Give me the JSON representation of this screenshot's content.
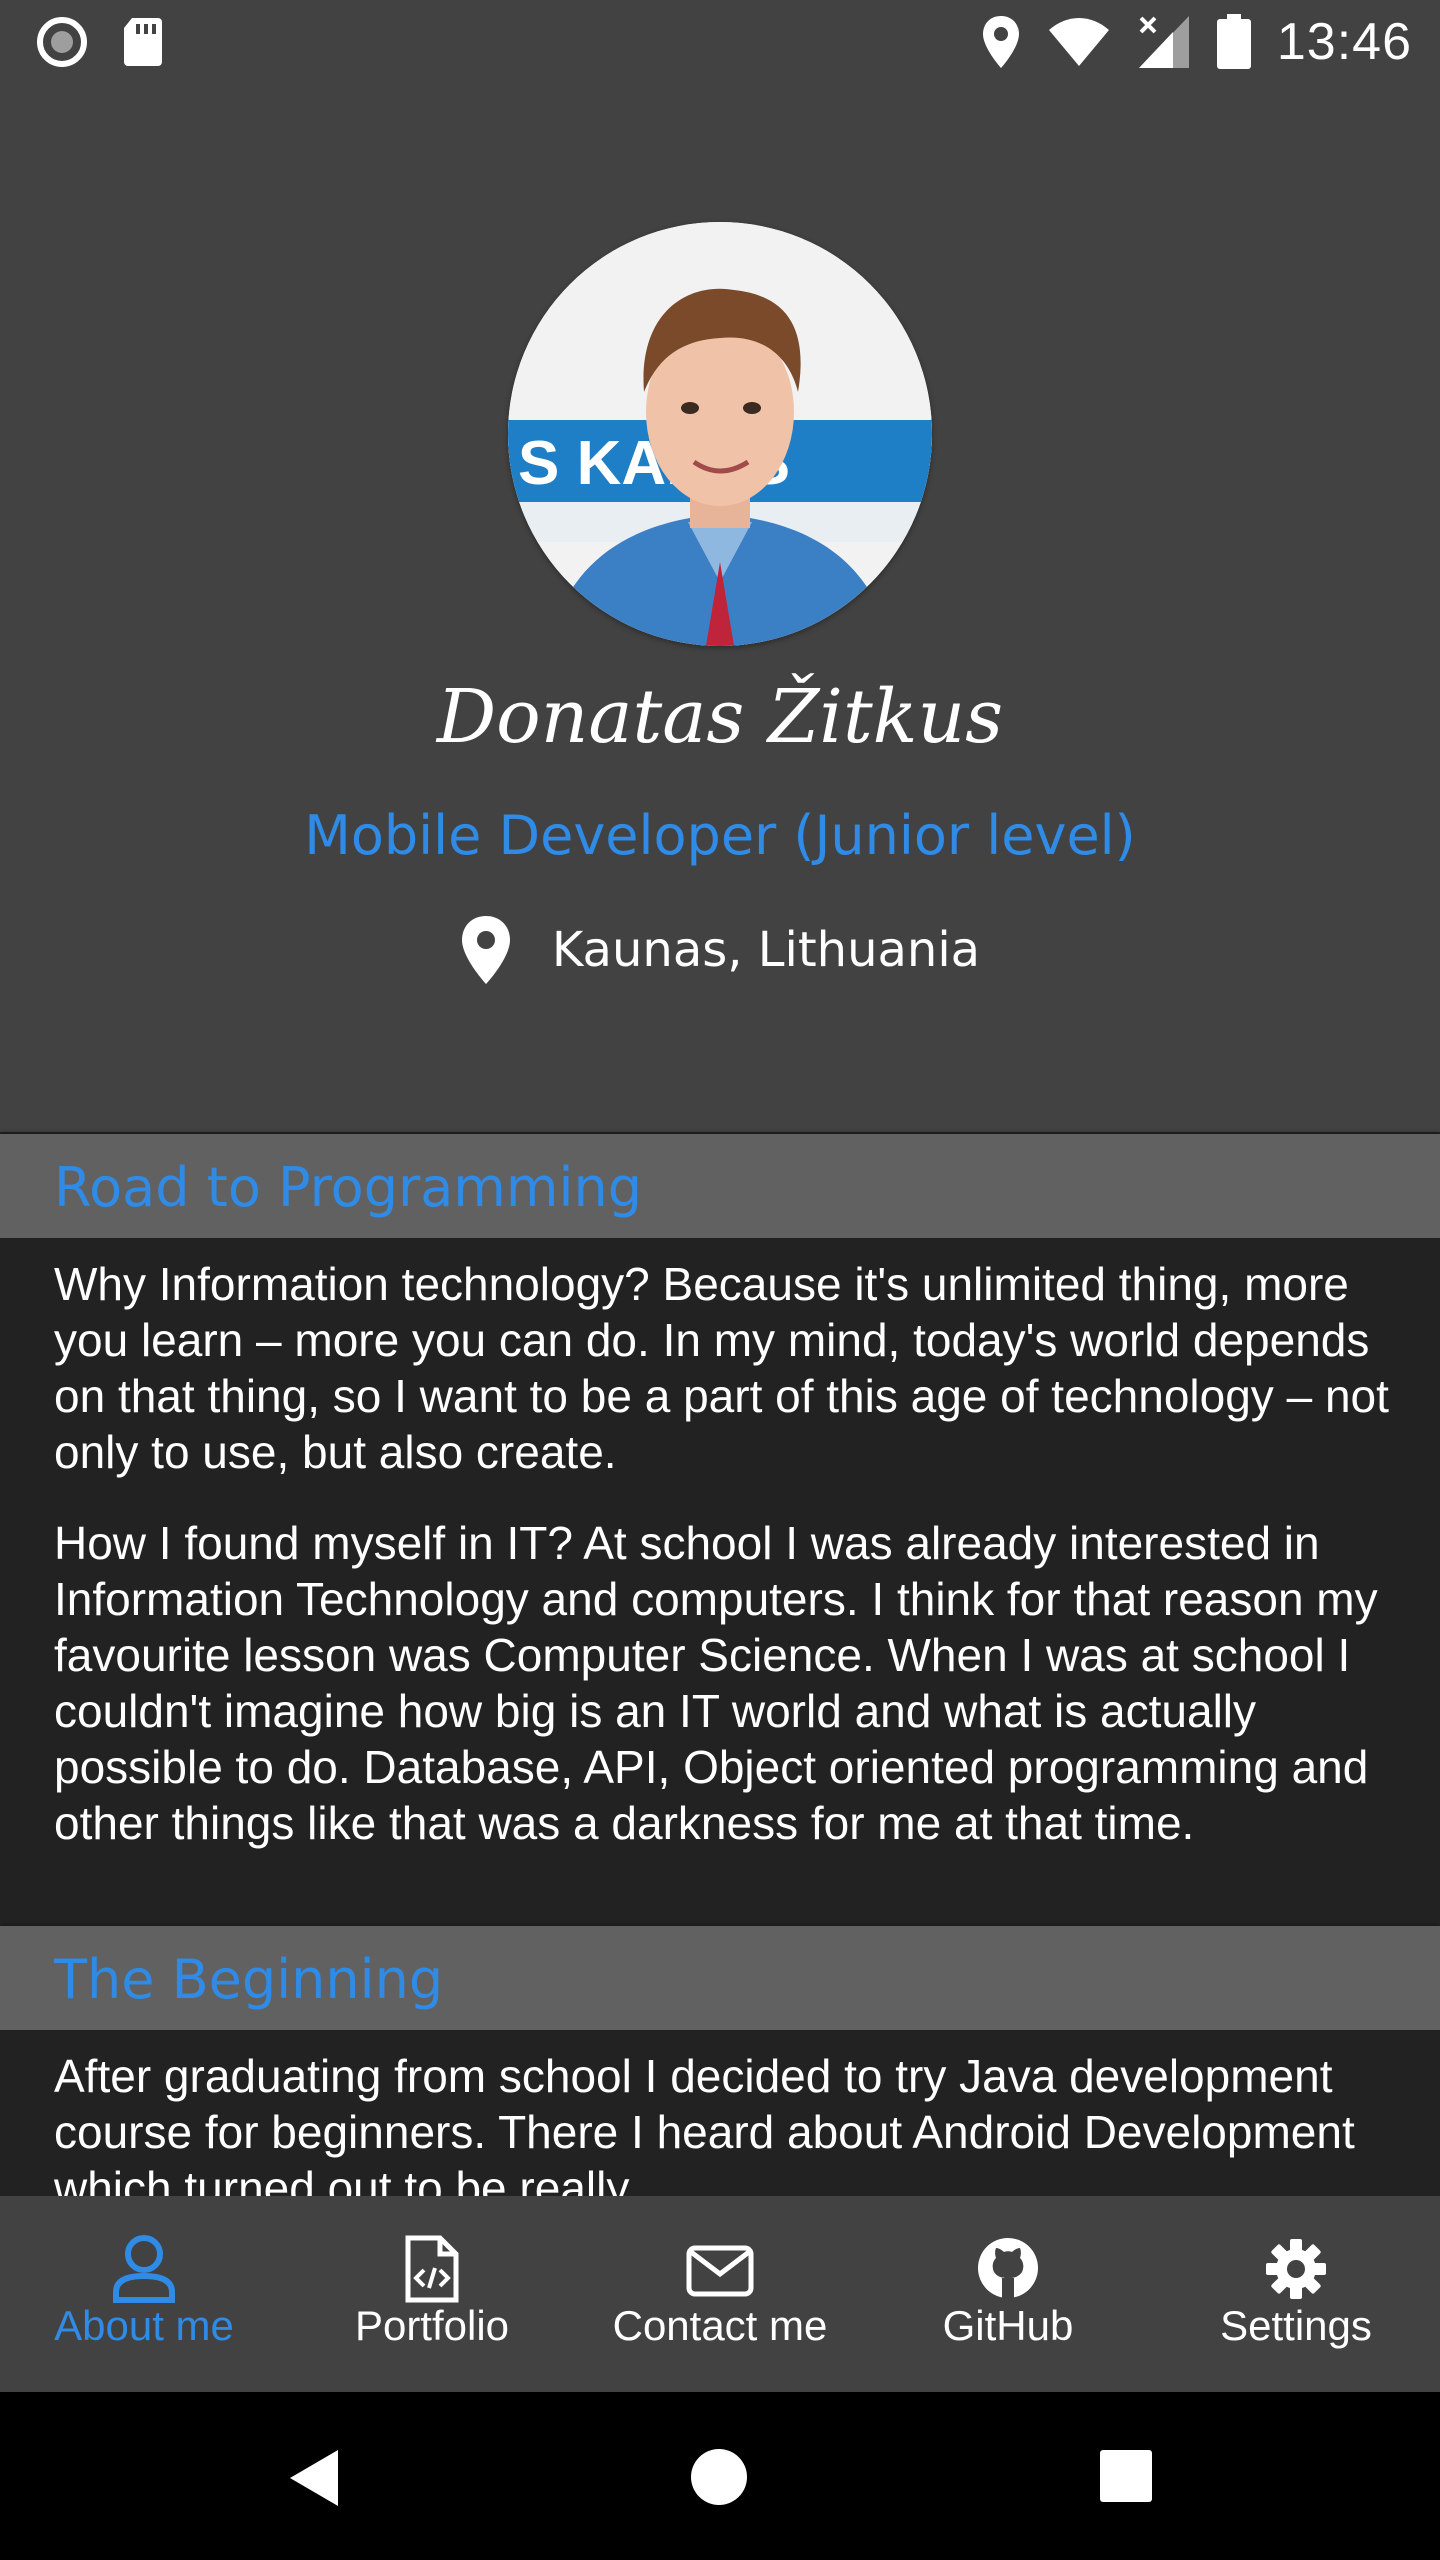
{
  "status_bar": {
    "time": "13:46"
  },
  "profile": {
    "name": "Donatas Žitkus",
    "role": "Mobile Developer (Junior level)",
    "location": "Kaunas, Lithuania",
    "avatar_sign_text": "S KAI  OS"
  },
  "sections": [
    {
      "title": "Road to Programming",
      "paragraphs": [
        "Why Information technology? Because it's unlimited thing, more you learn – more you can do. In my mind, today's world depends on that thing, so I want to be a part of this age of technology – not only to use, but also create.",
        "How I found myself in IT? At school I was already interested in Information Technology and computers. I think for that reason my favourite lesson was Computer Science. When I was at school I couldn't imagine how big is an IT world and what is actually possible to do. Database, API, Object oriented programming and other things like that was a darkness for me at that time."
      ]
    },
    {
      "title": "The Beginning",
      "paragraphs": [
        "After graduating from school I decided to try Java development course for beginners. There I heard about Android Development which turned out to be really"
      ]
    }
  ],
  "bottom_nav": {
    "items": [
      {
        "label": "About me",
        "icon": "person-icon",
        "active": true
      },
      {
        "label": "Portfolio",
        "icon": "code-file-icon",
        "active": false
      },
      {
        "label": "Contact me",
        "icon": "envelope-icon",
        "active": false
      },
      {
        "label": "GitHub",
        "icon": "github-icon",
        "active": false
      },
      {
        "label": "Settings",
        "icon": "gear-icon",
        "active": false
      }
    ]
  },
  "colors": {
    "accent": "#2f8be6",
    "header_bg": "#424242",
    "section_header_bg": "#616161",
    "content_bg": "#222222"
  }
}
